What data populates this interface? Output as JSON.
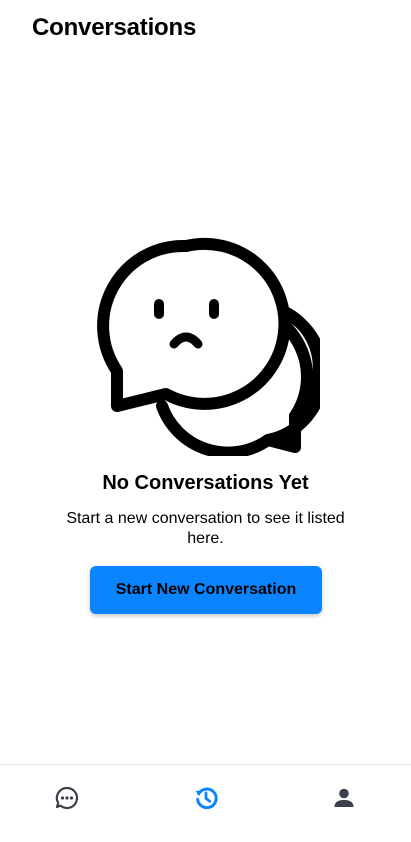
{
  "header": {
    "title": "Conversations"
  },
  "empty_state": {
    "icon": "sad-chat-bubbles-icon",
    "title": "No Conversations Yet",
    "description": "Start a new conversation to see it listed here.",
    "button_label": "Start New Conversation"
  },
  "bottom_nav": {
    "items": [
      {
        "icon": "chat-bubble-icon",
        "active": false
      },
      {
        "icon": "history-icon",
        "active": true
      },
      {
        "icon": "person-icon",
        "active": false
      }
    ]
  },
  "colors": {
    "accent": "#0a84ff",
    "nav_inactive": "#3a3f4b",
    "text": "#000000"
  }
}
